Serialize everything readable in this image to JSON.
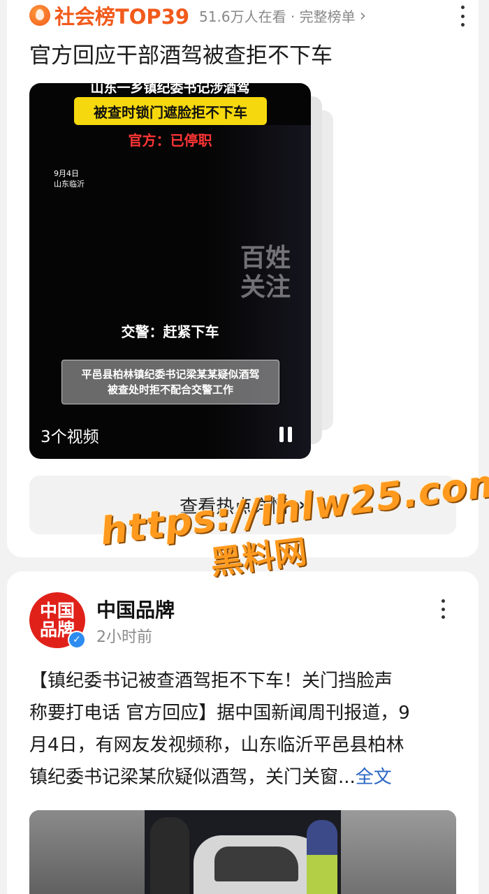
{
  "trending": {
    "rank_title": "社会榜TOP39",
    "meta": "51.6万人在看 · 完整榜单",
    "headline": "官方回应干部酒驾被查拒不下车",
    "video": {
      "top_text": "山东一乡镇纪委书记涉酒驾",
      "yellow_banner": "被查时锁门遮脸拒不下车",
      "red_text": "官方：已停职",
      "date_line1": "9月4日",
      "date_line2": "山东临沂",
      "watermark_line1": "百姓",
      "watermark_line2": "关注",
      "police_quote": "交警：赶紧下车",
      "caption_line1": "平邑县柏林镇纪委书记梁某某疑似酒驾",
      "caption_line2": "被查处时拒不配合交警工作",
      "video_count": "3个视频"
    },
    "detail_button": "查看热点详情"
  },
  "overlay_watermark": {
    "line1": "https://ihlw25.com",
    "line2": "黑料网"
  },
  "post": {
    "avatar_text_line1": "中国",
    "avatar_text_line2": "品牌",
    "author": "中国品牌",
    "time": "2小时前",
    "text_line1": "【镇纪委书记被查酒驾拒不下车！关门挡脸声",
    "text_line2": "称要打电话 官方回应】据中国新闻周刊报道，9",
    "text_line3": "月4日，有网友发视频称，山东临沂平邑县柏林",
    "text_line4": "镇纪委书记梁某欣疑似酒驾，关门关窗...",
    "full_text_link": "全文"
  },
  "colors": {
    "rank_accent": "#f25a1b",
    "banner_yellow": "#f5d90e",
    "official_red": "#ff3535",
    "link_blue": "#2a66c4",
    "verified_blue": "#2d8cf0",
    "avatar_red": "#e0211a"
  },
  "icons": [
    "fire-icon",
    "chevron-right-icon",
    "more-dots-icon",
    "pause-icon",
    "verified-icon"
  ]
}
